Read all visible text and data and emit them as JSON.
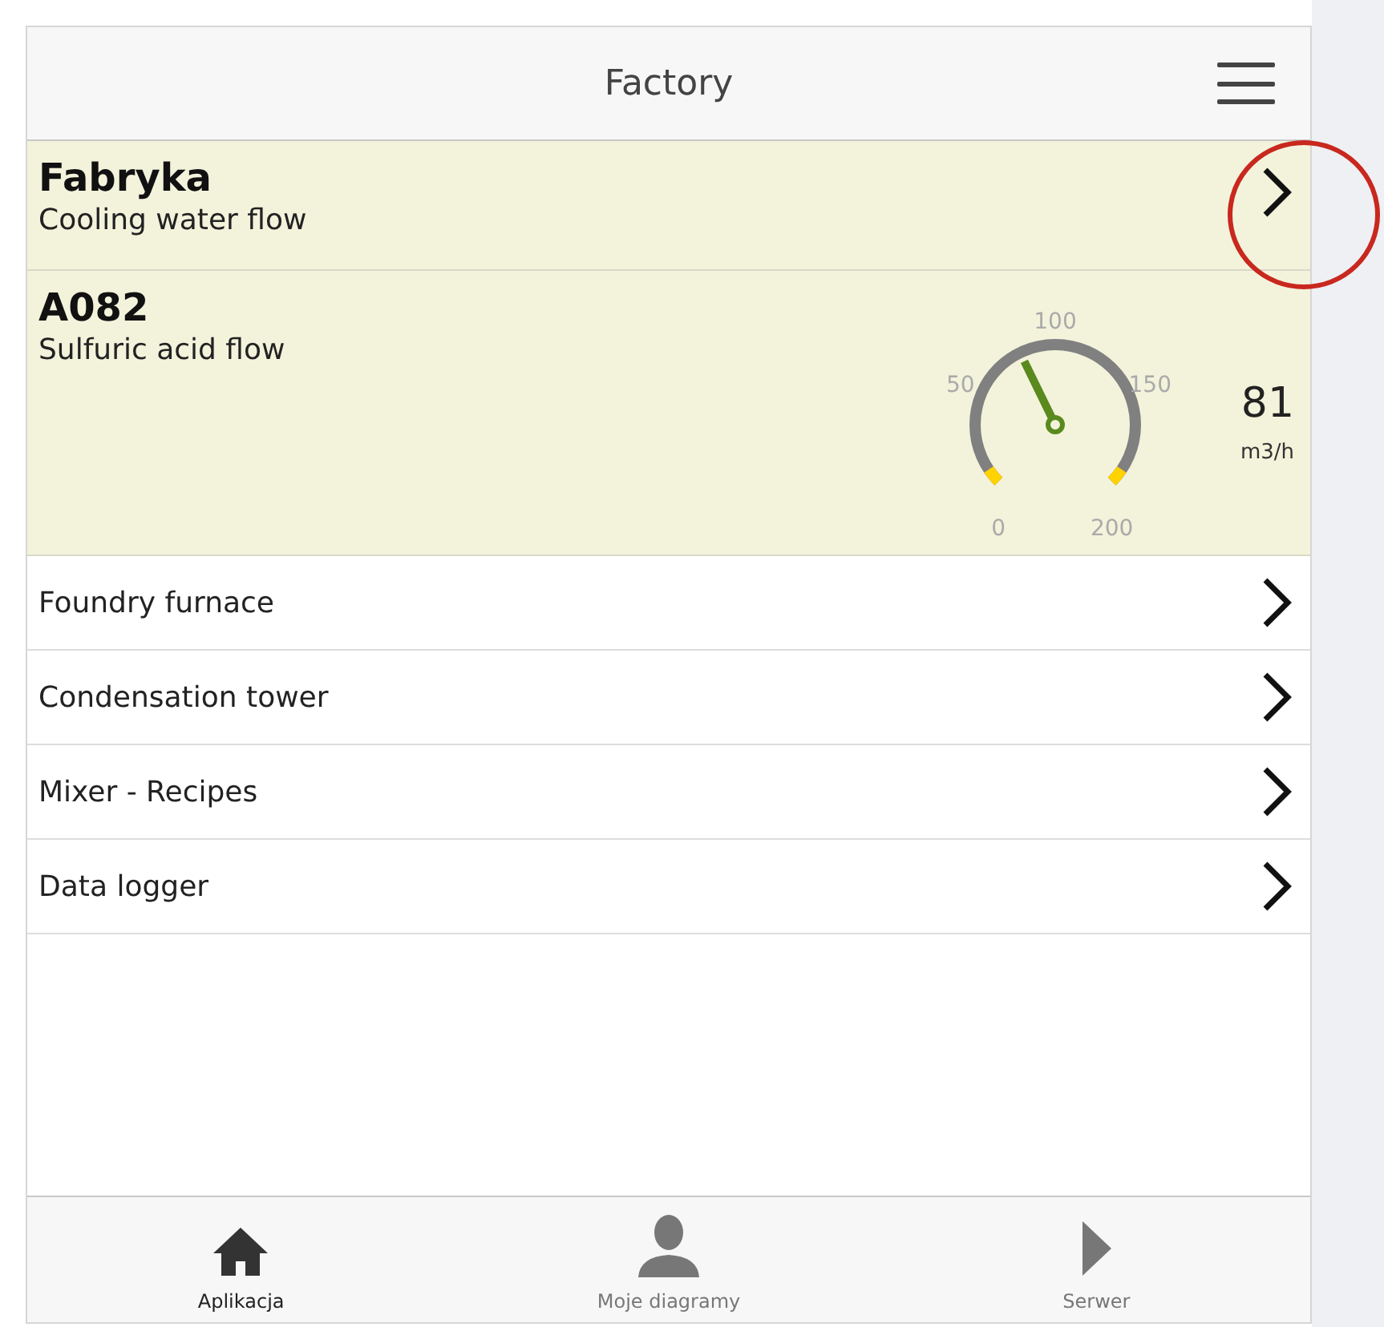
{
  "header": {
    "title": "Factory"
  },
  "highlight": {
    "kind": "circle",
    "color": "#c8281e"
  },
  "rows": [
    {
      "kind": "link",
      "title": "Fabryka",
      "subtitle": "Cooling water flow"
    },
    {
      "kind": "gauge",
      "title": "A082",
      "subtitle": "Sulfuric acid flow",
      "gauge": {
        "ticks": [
          "0",
          "50",
          "100",
          "150",
          "200"
        ],
        "value": "81",
        "unit": "m3/h"
      }
    }
  ],
  "items": [
    {
      "label": "Foundry furnace"
    },
    {
      "label": "Condensation tower"
    },
    {
      "label": "Mixer - Recipes"
    },
    {
      "label": "Data logger"
    }
  ],
  "tabs": [
    {
      "label": "Aplikacja",
      "selected": true
    },
    {
      "label": "Moje diagramy",
      "selected": false
    },
    {
      "label": "Serwer",
      "selected": false
    }
  ]
}
